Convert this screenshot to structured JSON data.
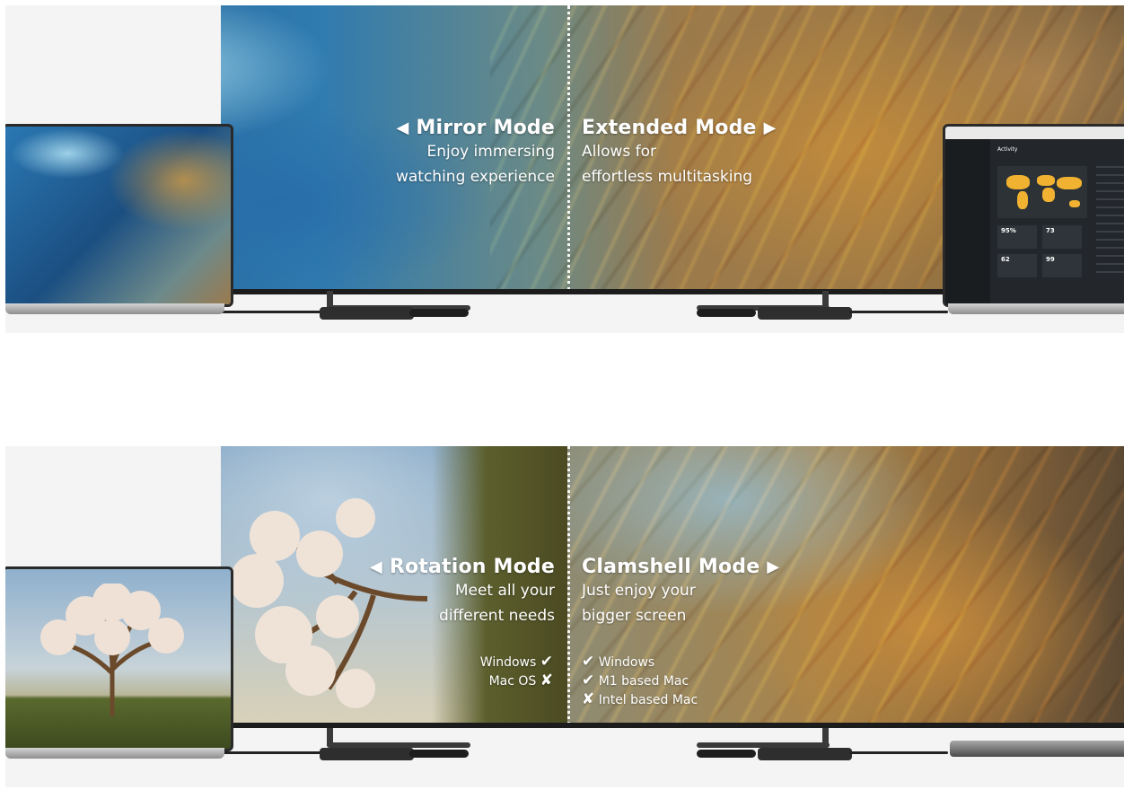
{
  "modes": {
    "mirror": {
      "title": "Mirror Mode",
      "line1": "Enjoy immersing",
      "line2": "watching experience"
    },
    "extended": {
      "title": "Extended Mode",
      "line1": "Allows for",
      "line2": "effortless multitasking"
    },
    "rotation": {
      "title": "Rotation Mode",
      "line1": "Meet all your",
      "line2": "different needs",
      "support": [
        {
          "label": "Windows",
          "mark": "✔"
        },
        {
          "label": "Mac OS",
          "mark": "✘"
        }
      ]
    },
    "clamshell": {
      "title": "Clamshell Mode",
      "line1": "Just enjoy your",
      "line2": "bigger screen",
      "support": [
        {
          "mark": "✔",
          "label": "Windows"
        },
        {
          "mark": "✔",
          "label": "M1 based Mac"
        },
        {
          "mark": "✘",
          "label": "Intel based Mac"
        }
      ]
    }
  },
  "dashboard": {
    "title": "Activity",
    "stats": [
      "95%",
      "73",
      "62",
      "99"
    ]
  },
  "icons": {
    "arrow_left": "◀",
    "arrow_right": "▶"
  },
  "colors": {
    "accent_yellow": "#f0b230",
    "dashboard_bg": "#23272b",
    "caption_text": "#ffffff"
  }
}
